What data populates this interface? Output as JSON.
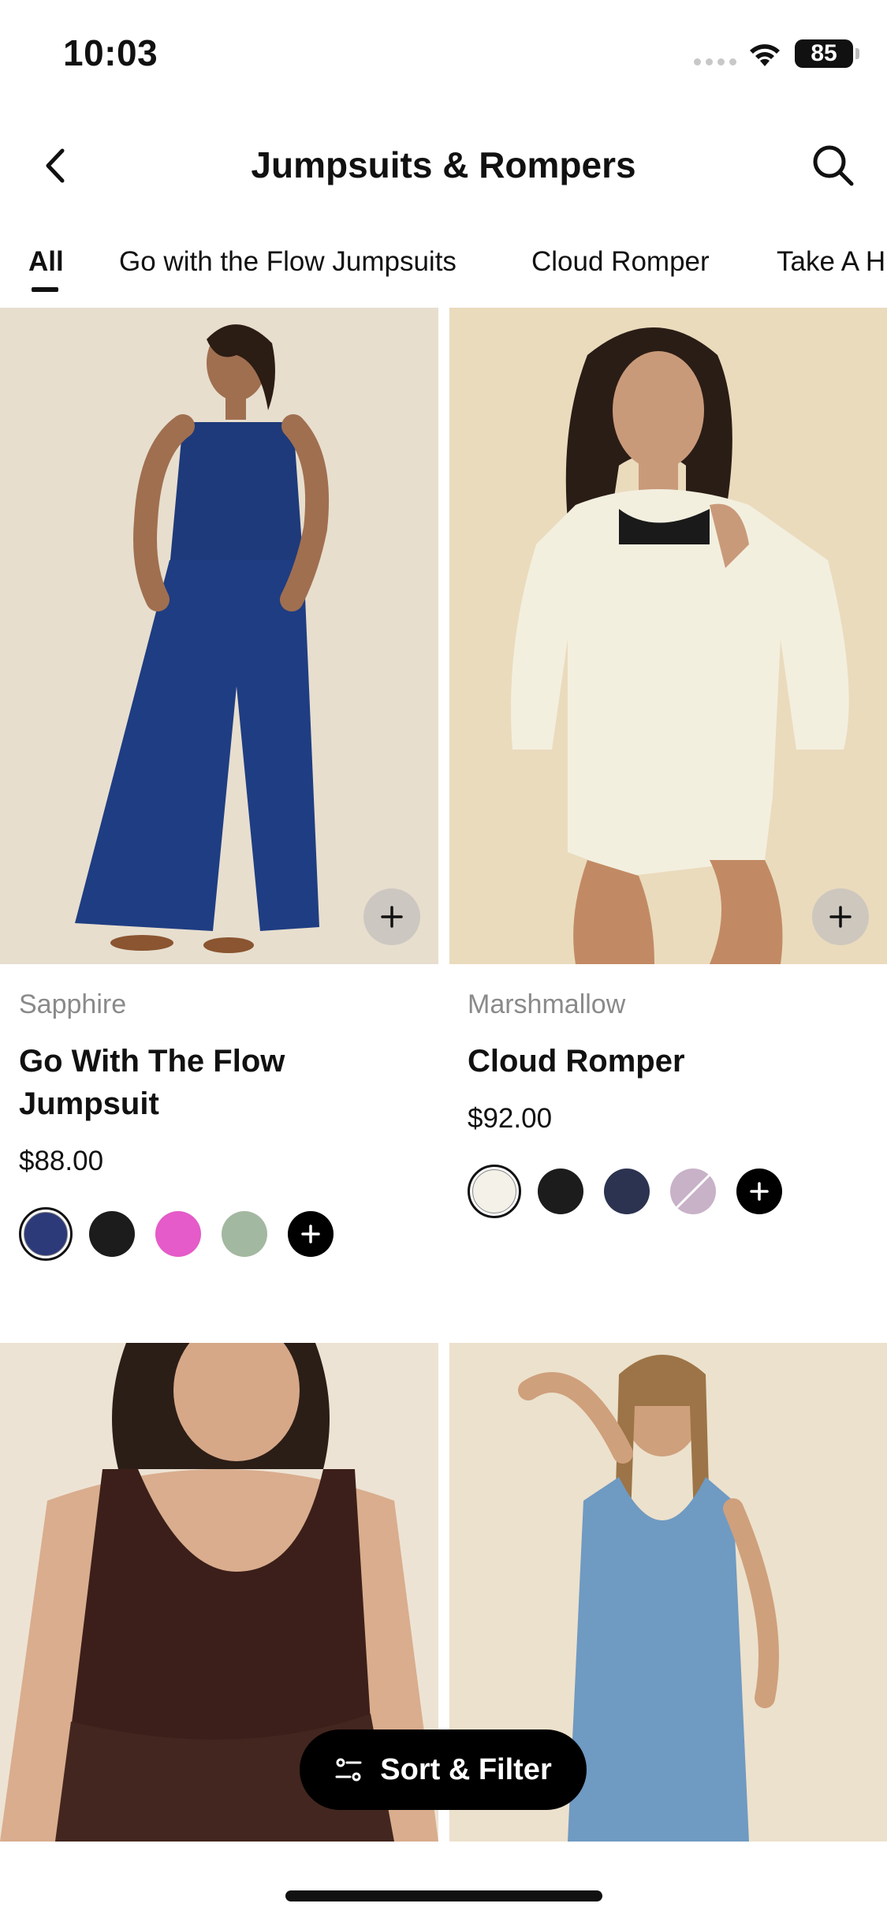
{
  "status_bar": {
    "time": "10:03",
    "battery": "85"
  },
  "header": {
    "title": "Jumpsuits & Rompers"
  },
  "tabs": [
    {
      "label": "All"
    },
    {
      "label": "Go with the Flow Jumpsuits"
    },
    {
      "label": "Cloud Romper"
    },
    {
      "label": "Take A H"
    }
  ],
  "products": [
    {
      "color_name": "Sapphire",
      "title": "Go With The Flow Jumpsuit",
      "price": "$88.00",
      "swatches": [
        "#2c3a7a",
        "#1c1c1c",
        "#e45bc9",
        "#a3b8a0"
      ]
    },
    {
      "color_name": "Marshmallow",
      "title": "Cloud Romper",
      "price": "$92.00",
      "swatches": [
        "#f3f1e8",
        "#1c1c1c",
        "#2c3350",
        "#c8b2c8"
      ]
    }
  ],
  "sort_filter": {
    "label": "Sort & Filter"
  },
  "colors": {
    "accent": "#000000",
    "muted_text": "#8a8a8a"
  }
}
